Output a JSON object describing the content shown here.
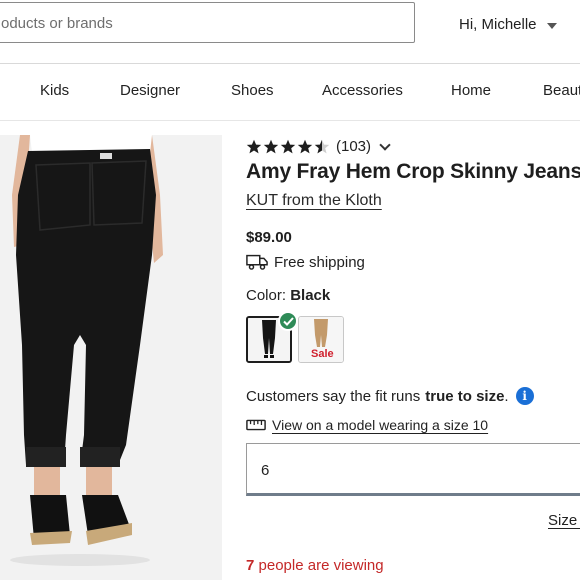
{
  "header": {
    "search_placeholder": "oducts or brands",
    "greeting": "Hi, Michelle"
  },
  "nav": {
    "items": [
      "Kids",
      "Designer",
      "Shoes",
      "Accessories",
      "Home",
      "Beaut"
    ]
  },
  "product": {
    "rating_value": 4.5,
    "review_count": "(103)",
    "title": "Amy Fray Hem Crop Skinny Jeans",
    "brand": "KUT from the Kloth",
    "price": "$89.00",
    "shipping": "Free shipping",
    "color_label": "Color:",
    "color_value": "Black",
    "swatches": [
      {
        "name": "Black",
        "selected": true,
        "badge": ""
      },
      {
        "name": "Tan",
        "selected": false,
        "badge": "Sale"
      }
    ],
    "fit_prefix": "Customers say the fit runs",
    "fit_value": "true to size",
    "fit_suffix": ".",
    "model_link": "View on a model wearing a size 10",
    "size_value": "6",
    "size_guide": "Size g",
    "viewing_count": "7",
    "viewing_text": "people are viewing"
  },
  "colors": {
    "selected_check": "#2e8b57",
    "info": "#1a6fd6",
    "sale": "#d0202e",
    "viewing": "#c42828"
  },
  "icons": {
    "stars": "star-icon",
    "dropdown": "chevron-down-icon",
    "shipping": "truck-icon",
    "info": "info-icon",
    "model": "measuring-tape-icon",
    "selected": "check-icon"
  }
}
